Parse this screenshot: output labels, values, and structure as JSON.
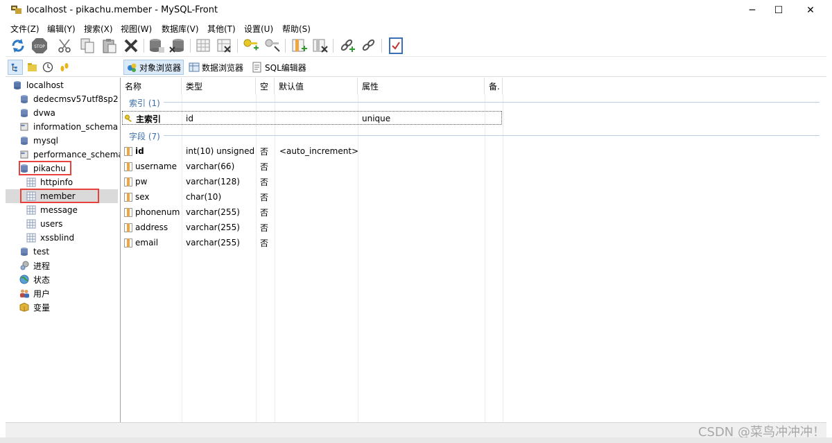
{
  "window": {
    "title": "localhost - pikachu.member - MySQL-Front",
    "minimize": "─",
    "maximize": "☐",
    "close": "✕"
  },
  "menu": [
    "文件(Z)",
    "编辑(Y)",
    "搜索(X)",
    "视图(W)",
    "数据库(V)",
    "其他(T)",
    "设置(U)",
    "帮助(S)"
  ],
  "toolbar_icons": [
    "refresh-icon",
    "stop-icon",
    "cut-icon",
    "copy-icon",
    "paste-icon",
    "delete-icon",
    "db-add-icon",
    "db-remove-icon",
    "table-add-icon",
    "table-remove-icon",
    "key-add-icon",
    "key-remove-icon",
    "field-add-icon",
    "field-remove-icon",
    "link-add-icon",
    "link-remove-icon",
    "properties-icon"
  ],
  "viewbar": {
    "tabs": [
      "对象浏览器",
      "数据浏览器",
      "SQL编辑器"
    ],
    "active": "对象浏览器"
  },
  "tree": {
    "root": "localhost",
    "databases": [
      "dedecmsv57utf8sp2",
      "dvwa",
      "information_schema",
      "mysql",
      "performance_schema",
      "pikachu"
    ],
    "pikachu_tables": [
      "httpinfo",
      "member",
      "message",
      "users",
      "xssblind"
    ],
    "after": [
      "test"
    ],
    "extra": [
      "进程",
      "状态",
      "用户",
      "变量"
    ],
    "selected": "member"
  },
  "grid": {
    "headers": [
      "名称",
      "类型",
      "空",
      "默认值",
      "属性",
      "备."
    ],
    "index_group": "索引 (1)",
    "index_row": {
      "name": "主索引",
      "type": "id",
      "attr": "unique"
    },
    "field_group": "字段 (7)",
    "fields": [
      {
        "name": "id",
        "type": "int(10) unsigned",
        "null": "否",
        "default": "<auto_increment>"
      },
      {
        "name": "username",
        "type": "varchar(66)",
        "null": "否",
        "default": ""
      },
      {
        "name": "pw",
        "type": "varchar(128)",
        "null": "否",
        "default": ""
      },
      {
        "name": "sex",
        "type": "char(10)",
        "null": "否",
        "default": ""
      },
      {
        "name": "phonenum",
        "type": "varchar(255)",
        "null": "否",
        "default": ""
      },
      {
        "name": "address",
        "type": "varchar(255)",
        "null": "否",
        "default": ""
      },
      {
        "name": "email",
        "type": "varchar(255)",
        "null": "否",
        "default": ""
      }
    ]
  },
  "watermark": "CSDN @菜鸟冲冲冲！",
  "colors": {
    "highlight": "#e8413c",
    "group_text": "#3c6ea8",
    "selected_bg": "#dadada"
  }
}
